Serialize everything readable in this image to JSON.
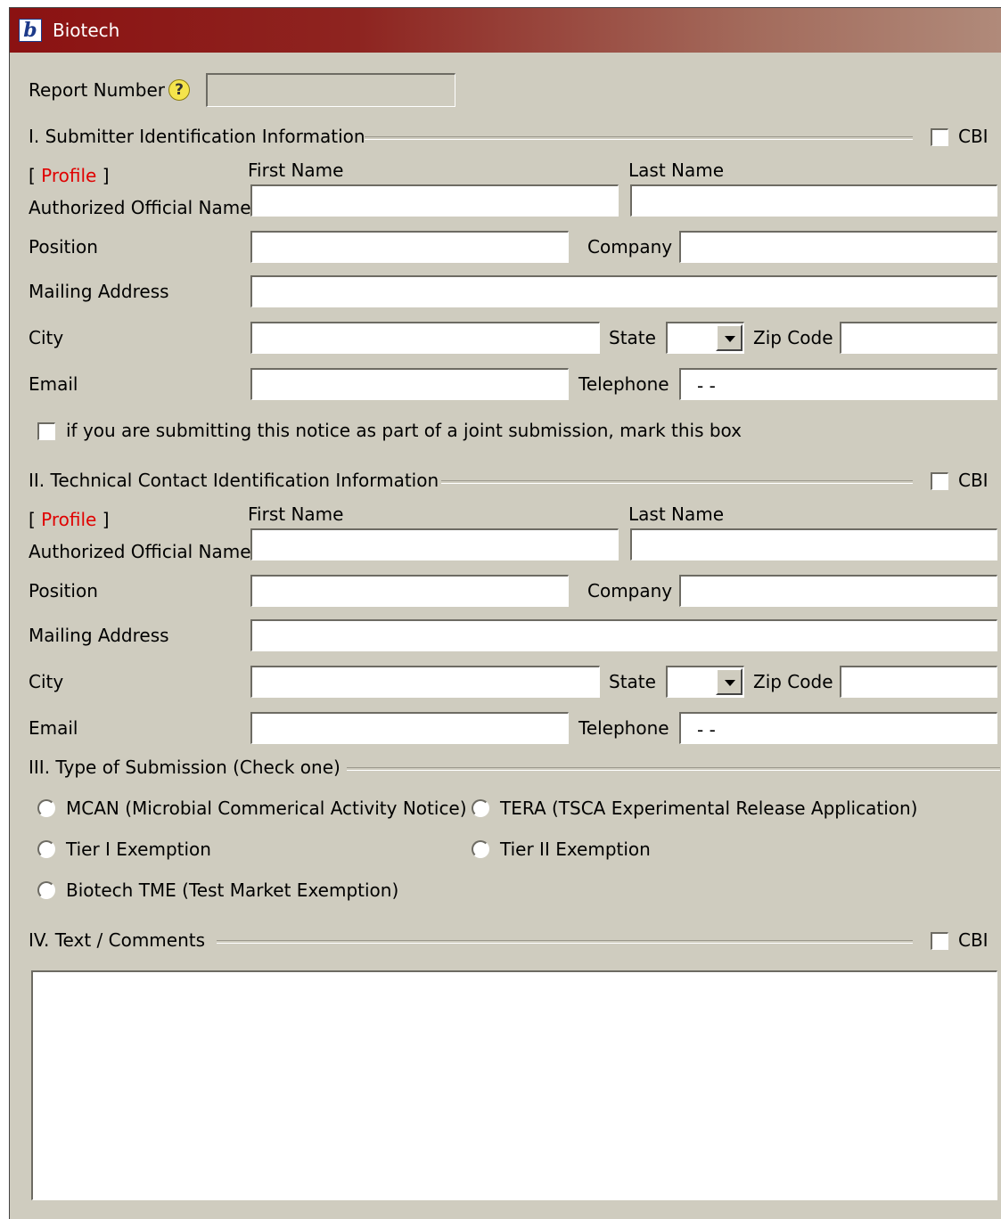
{
  "window": {
    "title": "Biotech",
    "logo_letter": "b"
  },
  "report": {
    "label": "Report Number",
    "help": "?",
    "value": ""
  },
  "cbi_label": "CBI",
  "profile": {
    "open": "[",
    "link": "Profile",
    "close": "]"
  },
  "fields": {
    "first_name": "First Name",
    "last_name": "Last Name",
    "authorized": "Authorized Official Name",
    "position": "Position",
    "company": "Company",
    "mailing": "Mailing Address",
    "city": "City",
    "state": "State",
    "zip": "Zip Code",
    "email": "Email",
    "telephone": "Telephone",
    "telephone_value": "- -"
  },
  "sections": {
    "s1": "I. Submitter Identification Information",
    "s2": "II. Technical Contact Identification Information",
    "s3": "III. Type of Submission (Check one)",
    "s4": "IV. Text / Comments"
  },
  "joint_submission": "if you are submitting this notice as part of a joint submission, mark this box",
  "submission_types": [
    "MCAN (Microbial Commerical Activity Notice)",
    "TERA (TSCA Experimental Release Application)",
    "Tier I Exemption",
    "Tier II Exemption",
    "Biotech TME (Test Market Exemption)"
  ]
}
